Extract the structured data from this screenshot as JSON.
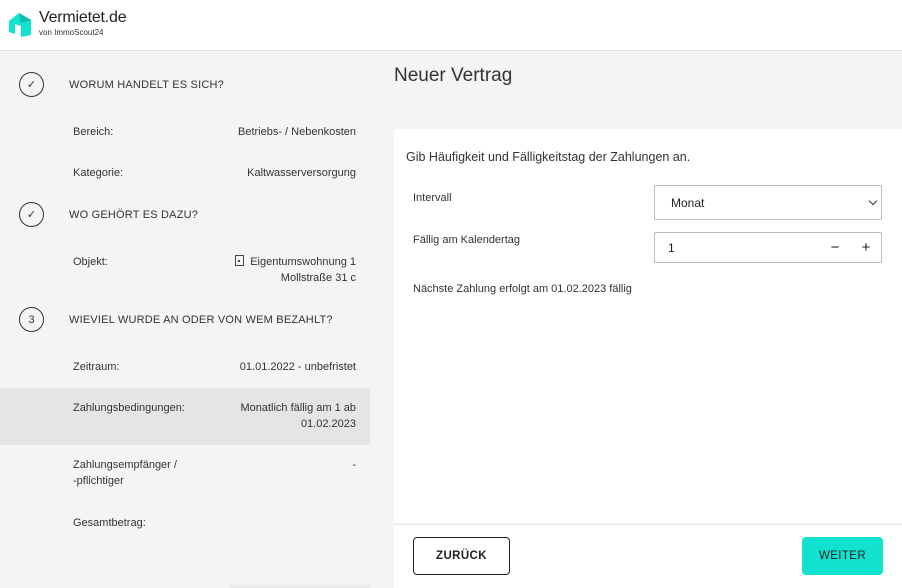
{
  "brand": {
    "name": "Vermietet.de",
    "subtitle": "von ImmoScout24",
    "accent_color": "#10e2cf"
  },
  "sidebar": {
    "steps": [
      {
        "marker": "✓",
        "title": "WORUM HANDELT ES SICH?",
        "rows": [
          {
            "label": "Bereich:",
            "value": "Betriebs- / Nebenkosten"
          },
          {
            "label": "Kategorie:",
            "value": "Kaltwasserversorgung"
          }
        ]
      },
      {
        "marker": "✓",
        "title": "WO GEHÖRT ES DAZU?",
        "rows": [
          {
            "label": "Objekt:",
            "value_line1": "Eigentumswohnung 1",
            "value_line2": "Mollstraße 31 c",
            "icon": "building-icon"
          }
        ]
      },
      {
        "marker": "3",
        "title": "WIEVIEL WURDE AN ODER VON WEM BEZAHLT?",
        "rows": [
          {
            "label": "Zeitraum:",
            "value": "01.01.2022 - unbefristet"
          },
          {
            "label": "Zahlungsbedingungen:",
            "value_line1": "Monatlich fällig am 1 ab",
            "value_line2": "01.02.2023",
            "active": true
          },
          {
            "label_line1": "Zahlungsempfänger /",
            "label_line2": "-pflichtiger",
            "value": "-"
          },
          {
            "label": "Gesamtbetrag:",
            "value": ""
          }
        ]
      }
    ]
  },
  "main": {
    "title": "Neuer Vertrag",
    "intro": "Gib Häufigkeit und Fälligkeitstag der Zahlungen an.",
    "interval": {
      "label": "Intervall",
      "value": "Monat"
    },
    "due_day": {
      "label": "Fällig am Kalendertag",
      "value": "1",
      "decrement": "−",
      "increment": "+"
    },
    "next_payment_text": "Nächste Zahlung erfolgt am 01.02.2023 fällig"
  },
  "footer": {
    "back_label": "ZURÜCK",
    "next_label": "WEITER"
  }
}
